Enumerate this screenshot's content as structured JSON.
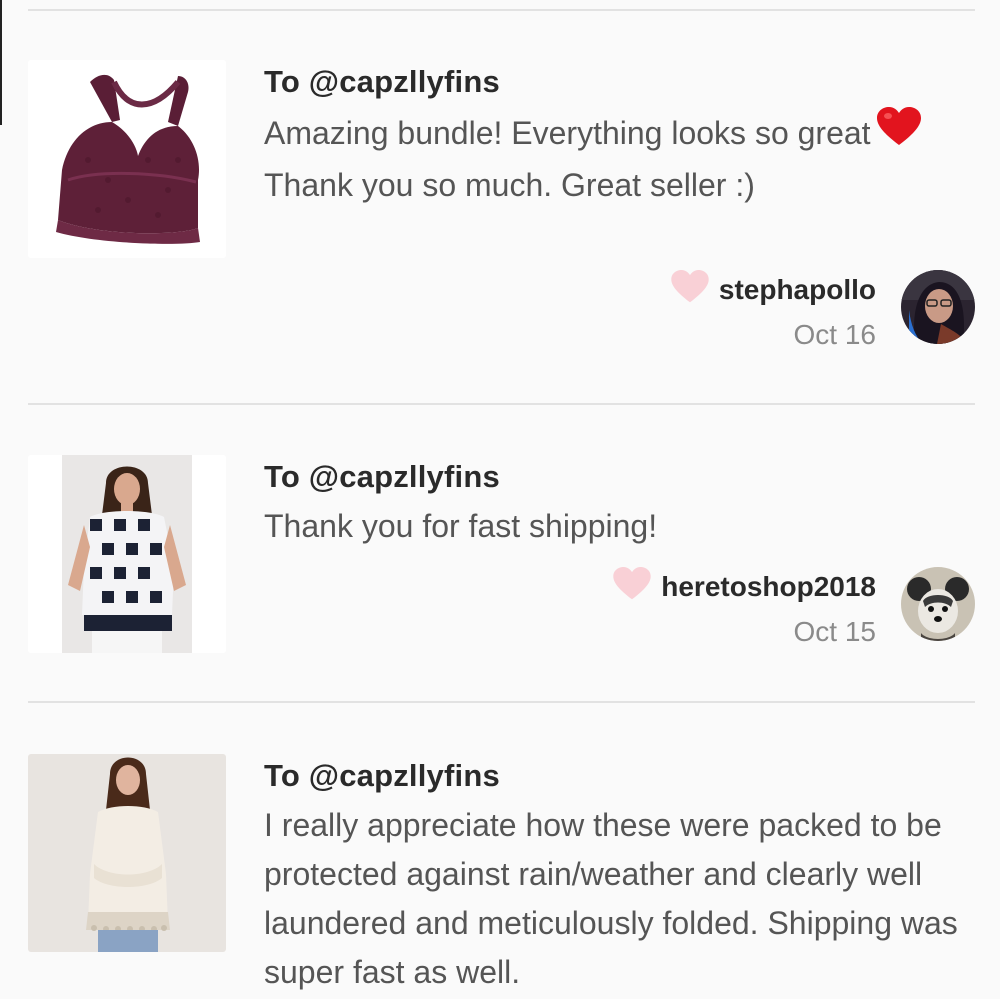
{
  "reviews": [
    {
      "to": "To @capzllyfins",
      "message_parts": [
        "Amazing bundle! Everything looks so great",
        "Thank you so much. Great seller :)"
      ],
      "inline_icon": "red-heart-emoji",
      "username": "stephapollo",
      "date": "Oct 16",
      "like_icon": "heart-icon",
      "like_color": "#f9d0d6"
    },
    {
      "to": "To @capzllyfins",
      "message": "Thank you for fast shipping!",
      "username": "heretoshop2018",
      "date": "Oct 15",
      "like_icon": "heart-icon",
      "like_color": "#f9d0d6"
    },
    {
      "to": "To @capzllyfins",
      "message": "I really appreciate how these were packed to be protected against rain/weather and clearly well laundered and meticulously folded. Shipping was super fast as well."
    }
  ],
  "colors": {
    "background": "#fafafa",
    "divider": "#e2e2e2",
    "heart_red": "#e2141e"
  }
}
